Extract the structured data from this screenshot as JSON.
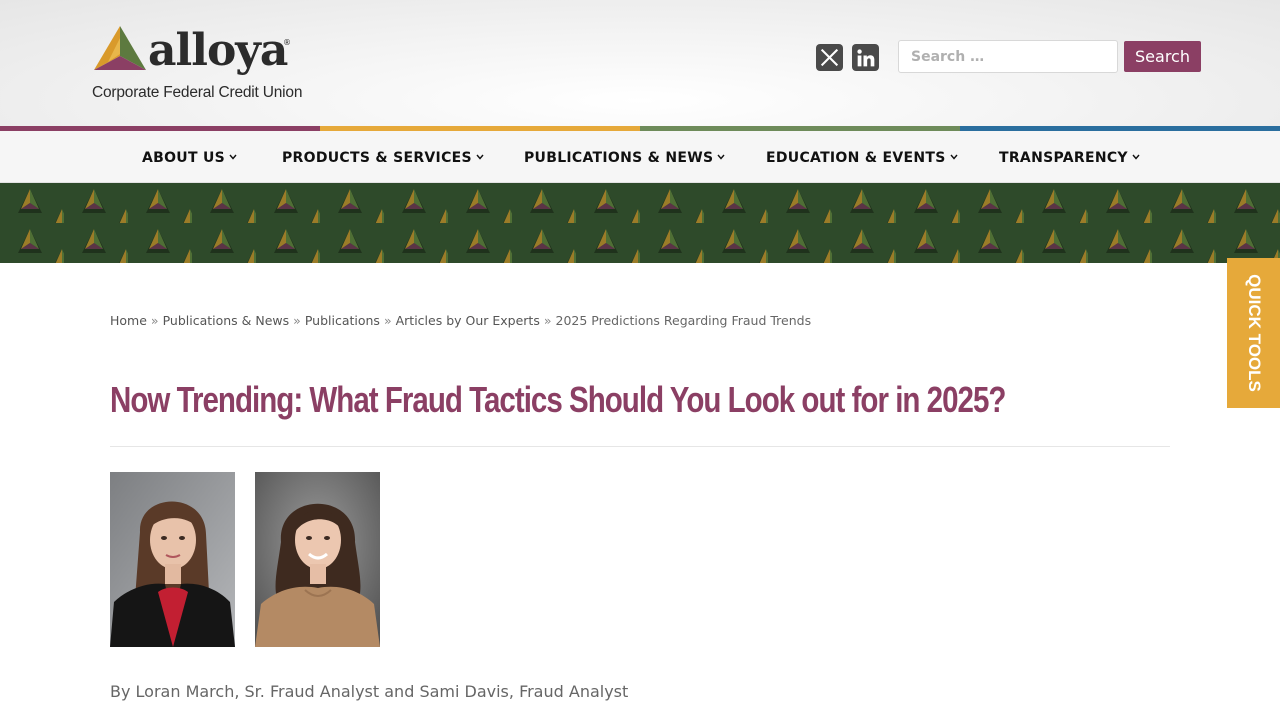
{
  "header": {
    "logo": {
      "wordmark": "alloya",
      "registered": "®",
      "tagline": "Corporate Federal Credit Union"
    },
    "social": [
      {
        "name": "x-icon"
      },
      {
        "name": "linkedin-icon"
      }
    ],
    "search": {
      "placeholder": "Search …",
      "value": "",
      "button_label": "Search"
    }
  },
  "colors": {
    "brand_plum": "#8b3f64",
    "brand_gold": "#e6a93a",
    "brand_green": "#6e8b5a",
    "brand_blue": "#2a6e9e",
    "banner_green": "#2e4a2a"
  },
  "nav": {
    "items": [
      {
        "label": "ABOUT US"
      },
      {
        "label": "PRODUCTS & SERVICES"
      },
      {
        "label": "PUBLICATIONS & NEWS"
      },
      {
        "label": "EDUCATION & EVENTS"
      },
      {
        "label": "TRANSPARENCY"
      }
    ]
  },
  "quick_tools": {
    "label": "QUICK TOOLS"
  },
  "breadcrumb": {
    "items": [
      "Home",
      "Publications & News",
      "Publications",
      "Articles by Our Experts"
    ],
    "current": "2025 Predictions Regarding Fraud Trends",
    "separator": "»"
  },
  "article": {
    "title": "Now Trending: What Fraud Tactics Should You Look out for in 2025?",
    "byline": "By Loran March, Sr. Fraud Analyst and Sami Davis, Fraud Analyst"
  }
}
